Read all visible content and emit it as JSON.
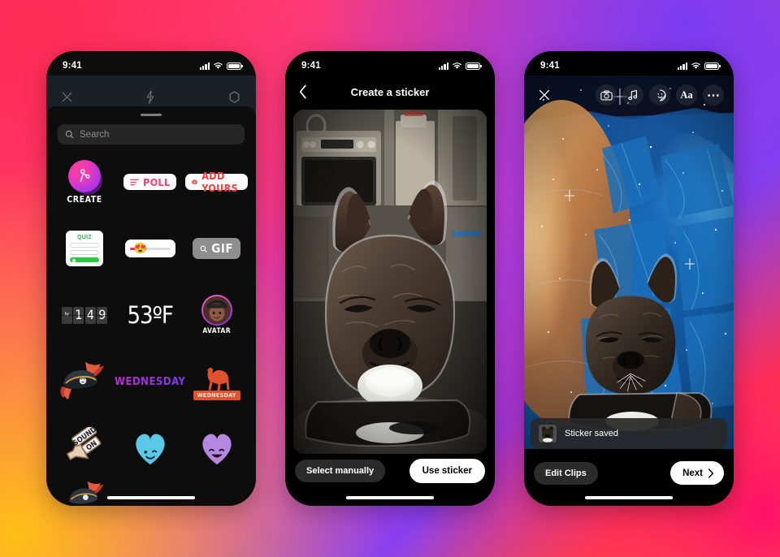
{
  "background": {
    "gradient_colors": [
      "#ff2e6a",
      "#f43a8e",
      "#8a3ff0",
      "#ff5a3c",
      "#ffbc18"
    ]
  },
  "status_bar": {
    "time": "9:41",
    "signal_icon": "cellular-bars-icon",
    "wifi_icon": "wifi-icon",
    "battery_icon": "battery-icon"
  },
  "phone1": {
    "name": "sticker-tray-screen",
    "overlay": {
      "close_icon": "close-icon",
      "flash_icon": "lightning-bolt-icon",
      "settings_icon": "hexagon-icon"
    },
    "search": {
      "placeholder": "Search",
      "icon": "search-icon"
    },
    "stickers": [
      {
        "id": "create",
        "label": "CREATE",
        "icon": "scissors-icon",
        "kind": "create-circle"
      },
      {
        "id": "poll",
        "label": "POLL",
        "icon": "poll-bars-icon",
        "kind": "pill",
        "color": "#ff3b6e"
      },
      {
        "id": "add-yours",
        "label": "ADD YOURS",
        "icon": "camera-icon",
        "kind": "pill",
        "color": "#ff3b3b"
      },
      {
        "id": "quiz",
        "label": "QUIZ",
        "kind": "quiz-card",
        "color": "#22bb44"
      },
      {
        "id": "slider",
        "label": "",
        "kind": "slider-card",
        "emoji": "😍"
      },
      {
        "id": "gif",
        "label": "GIF",
        "icon": "search-icon",
        "kind": "gif-chip"
      },
      {
        "id": "countdown",
        "label": "149",
        "kind": "flip-clock",
        "digits": [
          "1",
          "4",
          "9"
        ]
      },
      {
        "id": "temperature",
        "label": "53ºF",
        "kind": "temperature"
      },
      {
        "id": "avatar",
        "label": "AVATAR",
        "kind": "avatar"
      },
      {
        "id": "pirate-hat",
        "label": "",
        "kind": "art-hat"
      },
      {
        "id": "wednesday-text",
        "label": "WEDNESDAY",
        "kind": "art-text"
      },
      {
        "id": "camel-wednesday",
        "label": "WEDNESDAY",
        "kind": "art-camel"
      },
      {
        "id": "sound-on",
        "label": "SOUND ON",
        "kind": "art-sound"
      },
      {
        "id": "blue-heart",
        "label": "",
        "kind": "art-heart-blue"
      },
      {
        "id": "purple-heart",
        "label": "",
        "kind": "art-heart-purple"
      }
    ]
  },
  "phone2": {
    "name": "create-a-sticker-screen",
    "title": "Create a sticker",
    "back_icon": "chevron-left-icon",
    "photo_alt": "french-bulldog-cutout-photo",
    "buttons": {
      "secondary": "Select manually",
      "primary": "Use sticker"
    }
  },
  "phone3": {
    "name": "story-editor-screen",
    "toolbar": [
      {
        "id": "close",
        "icon": "close-icon"
      },
      {
        "id": "camera",
        "icon": "camera-icon"
      },
      {
        "id": "music",
        "icon": "music-note-icon"
      },
      {
        "id": "sticker",
        "icon": "sticker-smiley-icon"
      },
      {
        "id": "text",
        "icon": "text-aa-icon",
        "label": "Aa"
      },
      {
        "id": "more",
        "icon": "more-dots-icon"
      }
    ],
    "toast": {
      "text": "Sticker saved",
      "thumb": "dog-sticker-thumbnail"
    },
    "buttons": {
      "secondary": "Edit Clips",
      "primary": "Next",
      "primary_icon": "chevron-right-icon"
    }
  }
}
